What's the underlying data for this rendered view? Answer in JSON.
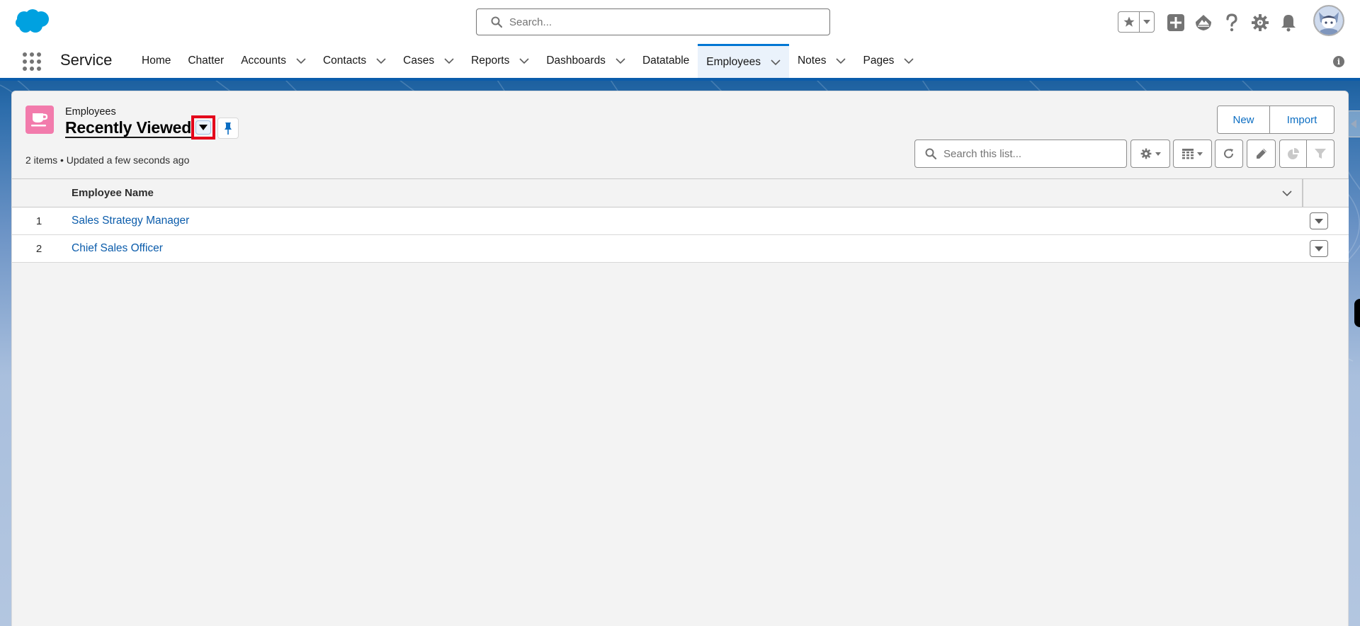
{
  "global_header": {
    "logo": "salesforce-cloud-logo",
    "search_placeholder": "Search...",
    "icons": [
      "favorites-star-icon",
      "favorites-dropdown-icon",
      "global-actions-plus-icon",
      "trailhead-guidance-icon",
      "help-icon",
      "setup-gear-icon",
      "notifications-bell-icon",
      "user-avatar"
    ]
  },
  "nav": {
    "app_name": "Service",
    "items": [
      {
        "label": "Home",
        "has_menu": false,
        "active": false
      },
      {
        "label": "Chatter",
        "has_menu": false,
        "active": false
      },
      {
        "label": "Accounts",
        "has_menu": true,
        "active": false
      },
      {
        "label": "Contacts",
        "has_menu": true,
        "active": false
      },
      {
        "label": "Cases",
        "has_menu": true,
        "active": false
      },
      {
        "label": "Reports",
        "has_menu": true,
        "active": false
      },
      {
        "label": "Dashboards",
        "has_menu": true,
        "active": false
      },
      {
        "label": "Datatable",
        "has_menu": false,
        "active": false
      },
      {
        "label": "Employees",
        "has_menu": true,
        "active": true
      },
      {
        "label": "Notes",
        "has_menu": true,
        "active": false
      },
      {
        "label": "Pages",
        "has_menu": true,
        "active": false
      }
    ],
    "info_icon": "i"
  },
  "list_view": {
    "object_label": "Employees",
    "object_icon": "coffee-cup-icon",
    "object_icon_color": "#f27bac",
    "title": "Recently Viewed",
    "meta": "2 items • Updated a few seconds ago",
    "buttons": {
      "new": "New",
      "import": "Import"
    },
    "search_placeholder": "Search this list...",
    "toolbar": [
      "list-view-controls-gear",
      "display-as-table",
      "refresh",
      "edit-list",
      "charts",
      "filters"
    ]
  },
  "table": {
    "columns": [
      "Employee Name"
    ],
    "rows": [
      {
        "num": "1",
        "name": "Sales Strategy Manager"
      },
      {
        "num": "2",
        "name": "Chief Sales Officer"
      }
    ]
  },
  "colors": {
    "brand_blue": "#0176d3",
    "link_blue": "#0b5cab",
    "highlight_red": "#e4001b"
  }
}
